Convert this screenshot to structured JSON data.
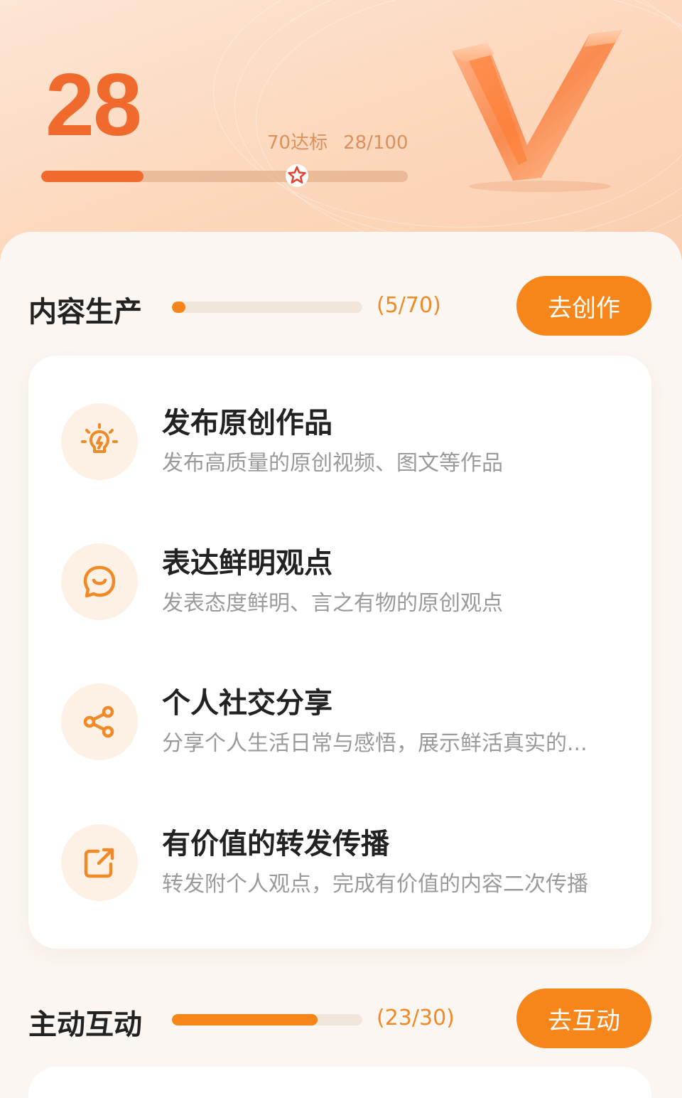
{
  "hero": {
    "score": "28",
    "target_label": "70达标",
    "progress_label": "28/100",
    "progress_fraction": 0.28,
    "accent_color": "#ef6a2c"
  },
  "sections": [
    {
      "title": "内容生产",
      "count": "(5/70)",
      "progress_fraction": 0.0714,
      "button_label": "去创作",
      "tasks": [
        {
          "icon": "lightbulb-icon",
          "title": "发布原创作品",
          "desc": "发布高质量的原创视频、图文等作品"
        },
        {
          "icon": "chat-smile-icon",
          "title": "表达鲜明观点",
          "desc": "发表态度鲜明、言之有物的原创观点"
        },
        {
          "icon": "share-icon",
          "title": "个人社交分享",
          "desc": "分享个人生活日常与感悟，展示鲜活真实的..."
        },
        {
          "icon": "forward-icon",
          "title": "有价值的转发传播",
          "desc": "转发附个人观点，完成有价值的内容二次传播"
        }
      ]
    },
    {
      "title": "主动互动",
      "count": "(23/30)",
      "progress_fraction": 0.7667,
      "button_label": "去互动"
    }
  ],
  "colors": {
    "button": "#f7861a",
    "icon": "#f08a26",
    "icon_bg": "#fdf1e6"
  }
}
